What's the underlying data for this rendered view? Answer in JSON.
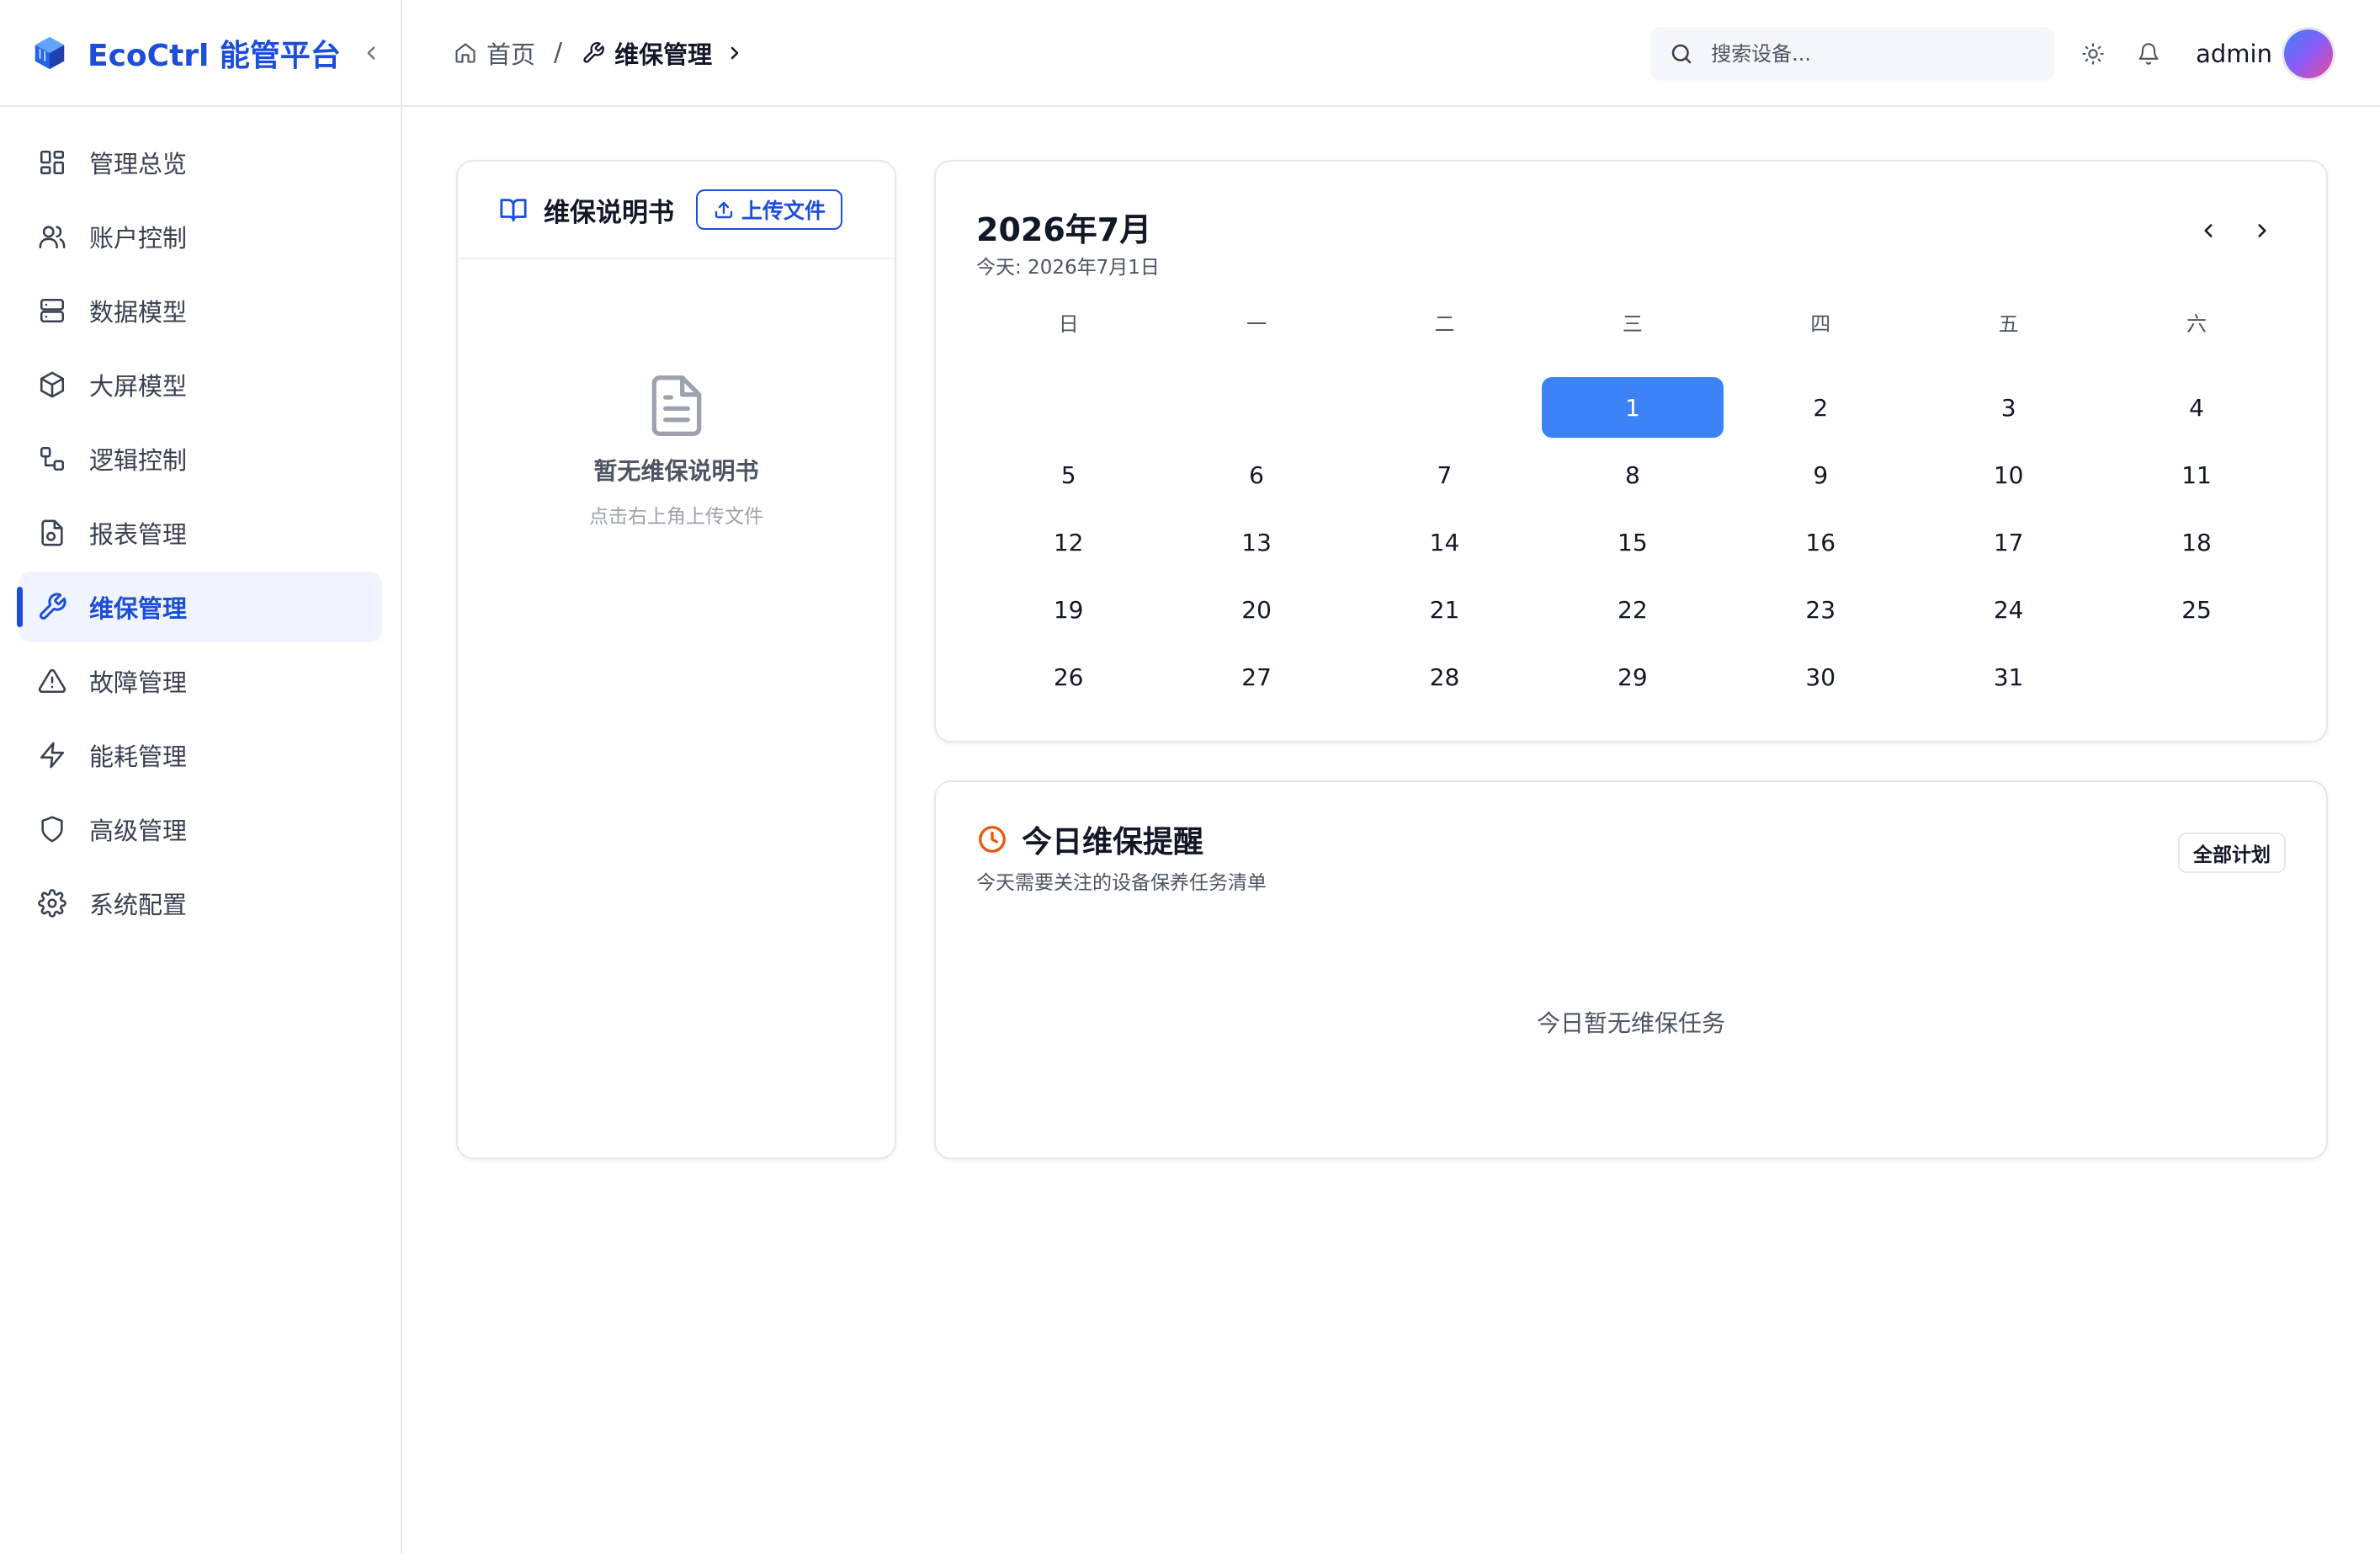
{
  "brand": {
    "name": "EcoCtrl 能管平台",
    "logo_icon": "cube-logo-icon",
    "color": "#1d4ed8"
  },
  "sidebar": {
    "items": [
      {
        "label": "管理总览",
        "icon": "dashboard-icon",
        "active": false
      },
      {
        "label": "账户控制",
        "icon": "users-icon",
        "active": false
      },
      {
        "label": "数据模型",
        "icon": "database-icon",
        "active": false
      },
      {
        "label": "大屏模型",
        "icon": "box-icon",
        "active": false
      },
      {
        "label": "逻辑控制",
        "icon": "workflow-icon",
        "active": false
      },
      {
        "label": "报表管理",
        "icon": "report-icon",
        "active": false
      },
      {
        "label": "维保管理",
        "icon": "wrench-icon",
        "active": true
      },
      {
        "label": "故障管理",
        "icon": "warning-icon",
        "active": false
      },
      {
        "label": "能耗管理",
        "icon": "lightning-icon",
        "active": false
      },
      {
        "label": "高级管理",
        "icon": "shield-icon",
        "active": false
      },
      {
        "label": "系统配置",
        "icon": "gear-icon",
        "active": false
      }
    ]
  },
  "header": {
    "breadcrumb": {
      "home": "首页",
      "separator": "/",
      "current": "维保管理"
    },
    "search_placeholder": "搜索设备...",
    "username": "admin"
  },
  "manual": {
    "title": "维保说明书",
    "upload_label": "上传文件",
    "empty_title": "暂无维保说明书",
    "empty_hint": "点击右上角上传文件"
  },
  "calendar": {
    "title": "2026年7月",
    "today_label": "今天: 2026年7月1日",
    "weekdays": [
      "日",
      "一",
      "二",
      "三",
      "四",
      "五",
      "六"
    ],
    "weeks": [
      [
        "",
        "",
        "",
        "1",
        "2",
        "3",
        "4"
      ],
      [
        "5",
        "6",
        "7",
        "8",
        "9",
        "10",
        "11"
      ],
      [
        "12",
        "13",
        "14",
        "15",
        "16",
        "17",
        "18"
      ],
      [
        "19",
        "20",
        "21",
        "22",
        "23",
        "24",
        "25"
      ],
      [
        "26",
        "27",
        "28",
        "29",
        "30",
        "31",
        ""
      ]
    ],
    "selected_day": "1",
    "accent": "#3b82f6"
  },
  "reminder": {
    "title": "今日维保提醒",
    "subtitle": "今天需要关注的设备保养任务清单",
    "all_plans_label": "全部计划",
    "empty_text": "今日暂无维保任务",
    "icon_color": "#ea580c"
  }
}
